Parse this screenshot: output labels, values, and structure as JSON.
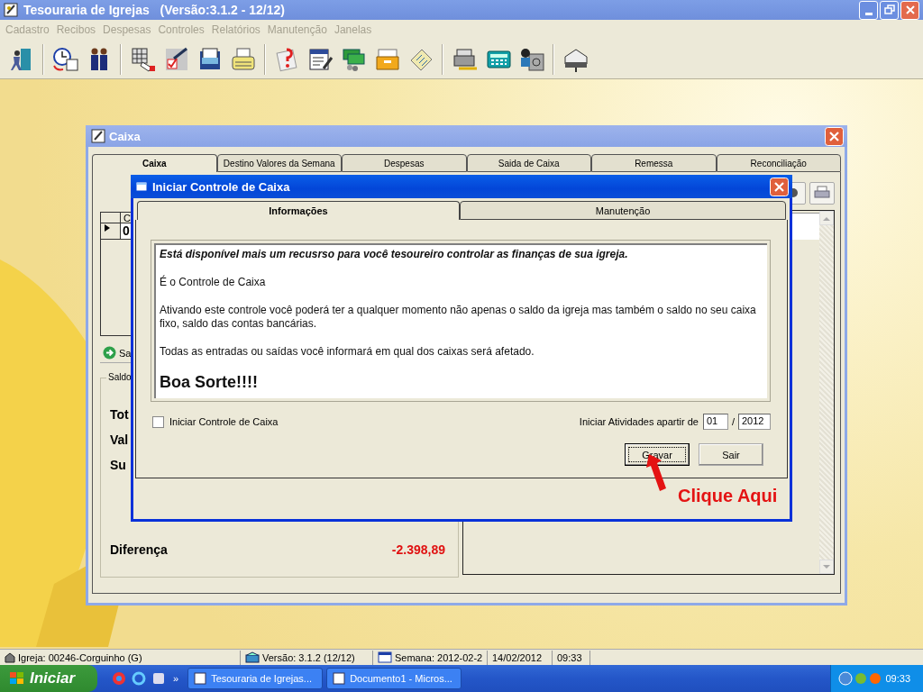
{
  "app": {
    "title": "Tesouraria de Igrejas",
    "version": "(Versão:3.1.2 - 12/12)"
  },
  "menu": [
    {
      "label": "Cadastro",
      "disabled": true
    },
    {
      "label": "Recibos",
      "disabled": true
    },
    {
      "label": "Despesas",
      "disabled": true
    },
    {
      "label": "Controles",
      "disabled": true
    },
    {
      "label": "Relatórios",
      "disabled": true
    },
    {
      "label": "Manutenção",
      "disabled": true
    },
    {
      "label": "Janelas",
      "disabled": true
    }
  ],
  "caixa_window": {
    "title": "Caixa",
    "tabs": [
      {
        "label": "Caixa",
        "selected": true
      },
      {
        "label": "Destino Valores da Semana",
        "selected": false
      },
      {
        "label": "Despesas",
        "selected": false
      },
      {
        "label": "Saida de Caixa",
        "selected": false
      },
      {
        "label": "Remessa",
        "selected": false
      },
      {
        "label": "Reconciliação",
        "selected": false
      }
    ],
    "grid": {
      "column_header": "C",
      "cell": "0"
    },
    "button": "Sa",
    "saldo": {
      "legend": "Saldo",
      "rows": [
        {
          "label": "Tot"
        },
        {
          "label": "Val"
        },
        {
          "label": "Su"
        },
        {
          "label": "Diferença",
          "value": "-2.398,89"
        }
      ]
    }
  },
  "dialog": {
    "title": "Iniciar Controle de Caixa",
    "tabs": [
      {
        "label": "Informações",
        "selected": true
      },
      {
        "label": "Manutenção",
        "selected": false
      }
    ],
    "paragraphs": [
      {
        "kind": "lead",
        "text": "Está disponível mais um recusrso para você tesoureiro controlar as finanças de sua igreja."
      },
      {
        "kind": "body",
        "text": "É o Controle de Caixa"
      },
      {
        "kind": "body",
        "text": "Ativando este controle você poderá ter a qualquer momento não apenas o saldo da igreja mas também o saldo no seu caixa fixo, saldo das contas bancárias."
      },
      {
        "kind": "body",
        "text": "Todas as entradas ou saídas você informará em qual dos caixas será afetado."
      },
      {
        "kind": "closing",
        "text": "Boa Sorte!!!!"
      }
    ],
    "checkbox": {
      "label": "Iniciar Controle de Caixa",
      "checked": false
    },
    "start_label": "Iniciar Atividades apartir de",
    "month": "01",
    "separator": "/",
    "year": "2012",
    "buttons": [
      {
        "label": "Gravar",
        "focused": true
      },
      {
        "label": "Sair",
        "focused": false
      }
    ]
  },
  "annotation": {
    "text": "Clique Aqui"
  },
  "status_bar": [
    {
      "kind": "church",
      "text": "Igreja: 00246-Corguinho (G)"
    },
    {
      "kind": "version",
      "text": "Versão: 3.1.2 (12/12)"
    },
    {
      "kind": "week",
      "text": "Semana: 2012-02-2"
    },
    {
      "kind": "plain",
      "text": "14/02/2012"
    },
    {
      "kind": "plain",
      "text": "09:33"
    }
  ],
  "taskbar": {
    "start": "Iniciar",
    "more": "»",
    "tasks": [
      {
        "label": "Tesouraria de Igrejas..."
      },
      {
        "label": "Documento1 - Micros..."
      }
    ],
    "clock": "09:33"
  }
}
